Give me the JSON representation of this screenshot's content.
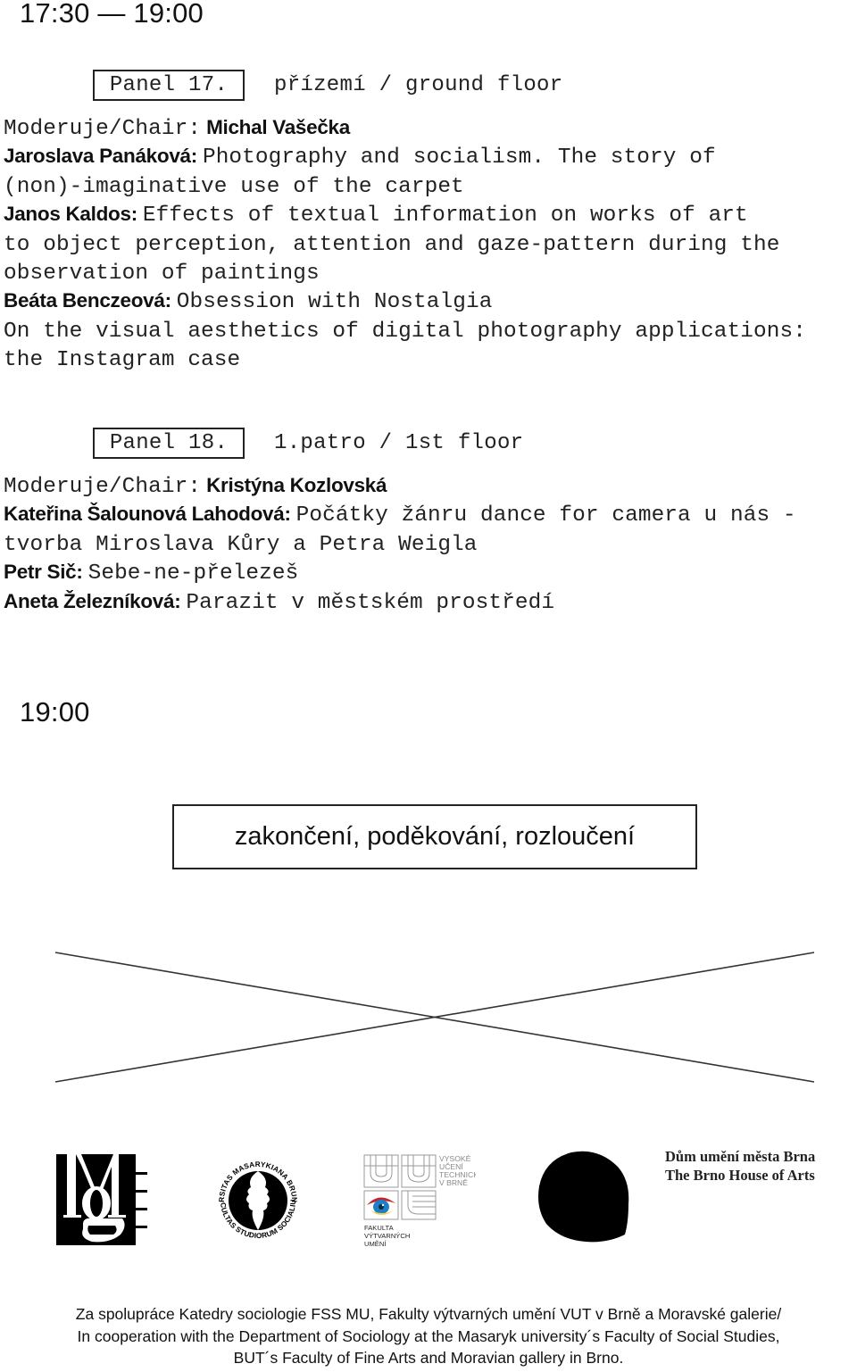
{
  "session1": {
    "time": "17:30 — 19:00",
    "panels": [
      {
        "label": "Panel 17.",
        "floor": "přízemí / ground floor",
        "chair_label": "Moderuje/Chair:",
        "chair_name": "Michal Vašečka",
        "talks": [
          {
            "speaker": "Jaroslava Panáková:",
            "title_lines": [
              "Photography and socialism. The story of",
              "(non)-imaginative use of the carpet"
            ]
          },
          {
            "speaker": "Janos Kaldos:",
            "title_lines": [
              "Effects of textual information on works of art",
              "to object perception, attention and gaze-pattern during the",
              "observation of paintings"
            ]
          },
          {
            "speaker": "Beáta Benczeová:",
            "title_lines": [
              "Obsession with Nostalgia",
              "On the visual aesthetics of digital photography applications:",
              "the Instagram case"
            ]
          }
        ]
      },
      {
        "label": "Panel 18.",
        "floor": "1.patro / 1st floor",
        "chair_label": "Moderuje/Chair:",
        "chair_name": "Kristýna Kozlovská",
        "talks": [
          {
            "speaker": "Kateřina Šalounová Lahodová:",
            "title_lines": [
              "Počátky žánru dance for camera u nás -",
              "tvorba Miroslava Kůry a Petra Weigla"
            ]
          },
          {
            "speaker": "Petr Sič:",
            "title_lines": [
              "Sebe-ne-přelezeš"
            ]
          },
          {
            "speaker": "Aneta Železníková:",
            "title_lines": [
              "Parazit v městském prostředí"
            ]
          }
        ]
      }
    ]
  },
  "session2": {
    "time": "19:00",
    "closing": "zakončení, poděkování, rozloučení"
  },
  "logos": {
    "mg": {
      "icon": "moravian-gallery-logo"
    },
    "fss": {
      "icon": "fss-mu-seal-logo",
      "ring_top": "UNIVERSITAS MASARYKIANA BRUNENSIS",
      "ring_bottom": "FACULTAS STUDIORUM SOCIALIUM"
    },
    "vut": {
      "icon": "vut-ffa-logo",
      "lines_top": [
        "VYSOKÉ",
        "UČENÍ",
        "TECHNICKÉ",
        "V BRNĚ"
      ],
      "lines_bottom": [
        "FAKULTA",
        "VÝTVARNÝCH",
        "UMĚNÍ"
      ]
    },
    "blob": {
      "icon": "black-blob-logo"
    },
    "brno_house": {
      "line1": "Dům umění města Brna",
      "line2": "The Brno House of Arts"
    }
  },
  "footer": {
    "lines": [
      "Za spolupráce Katedry sociologie FSS MU, Fakulty výtvarných umění VUT v Brně a Moravské galerie/",
      "In cooperation with the Department of Sociology at the Masaryk university´s Faculty of Social Studies,",
      "BUT´s Faculty of Fine Arts and Moravian gallery in Brno."
    ]
  },
  "colors": {
    "ink": "#111111",
    "background": "#ffffff",
    "vut_grey": "#9a9a9a",
    "eye_red": "#c8232c",
    "eye_blue": "#1f7fc4",
    "eye_yellow": "#f2d04b"
  }
}
